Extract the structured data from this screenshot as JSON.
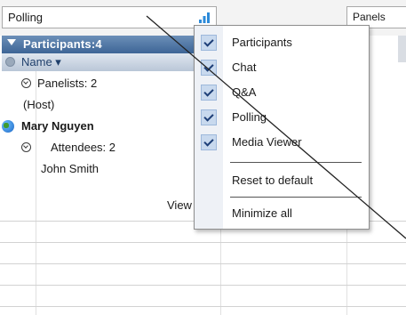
{
  "toolbar": {
    "polling_field": "Polling",
    "panels_button": "Panels"
  },
  "participants_panel": {
    "header": "Participants:4",
    "column_header": "Name",
    "rows": {
      "panelists": "Panelists: 2",
      "host": "(Host)",
      "mary": "Mary Nguyen",
      "attendees": "Attendees: 2",
      "john": "John Smith"
    },
    "view_text": "View"
  },
  "panels_menu": {
    "items": [
      {
        "label": "Participants",
        "checked": true
      },
      {
        "label": "Chat",
        "checked": true
      },
      {
        "label": "Q&A",
        "checked": true
      },
      {
        "label": "Polling",
        "checked": true
      },
      {
        "label": "Media Viewer",
        "checked": true
      }
    ],
    "reset": "Reset to default",
    "minimize": "Minimize all"
  },
  "colors": {
    "panel_header": "#4a6f9c",
    "check_box": "#c8d9ee",
    "signal_icon": "#2b8ad9"
  }
}
